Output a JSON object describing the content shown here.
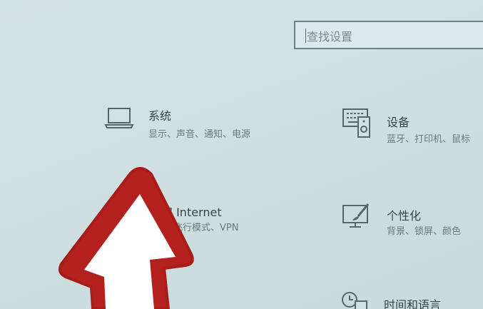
{
  "search": {
    "placeholder": "查找设置"
  },
  "tiles": [
    {
      "title": "系统",
      "desc": "显示、声音、通知、电源",
      "icon": "laptop-icon"
    },
    {
      "title": "设备",
      "desc": "蓝牙、打印机、鼠标",
      "icon": "devices-icon"
    },
    {
      "title": "和 Internet",
      "desc": "、飞行模式、VPN",
      "icon": "network-icon"
    },
    {
      "title": "个性化",
      "desc": "背景、锁屏、颜色",
      "icon": "personalization-icon"
    },
    {
      "title": "时间和语言",
      "desc": "",
      "icon": "clock-icon"
    }
  ],
  "colors": {
    "background": "#d0e0e3",
    "overlay_arrow": "#b3201e",
    "text": "#37454b"
  }
}
